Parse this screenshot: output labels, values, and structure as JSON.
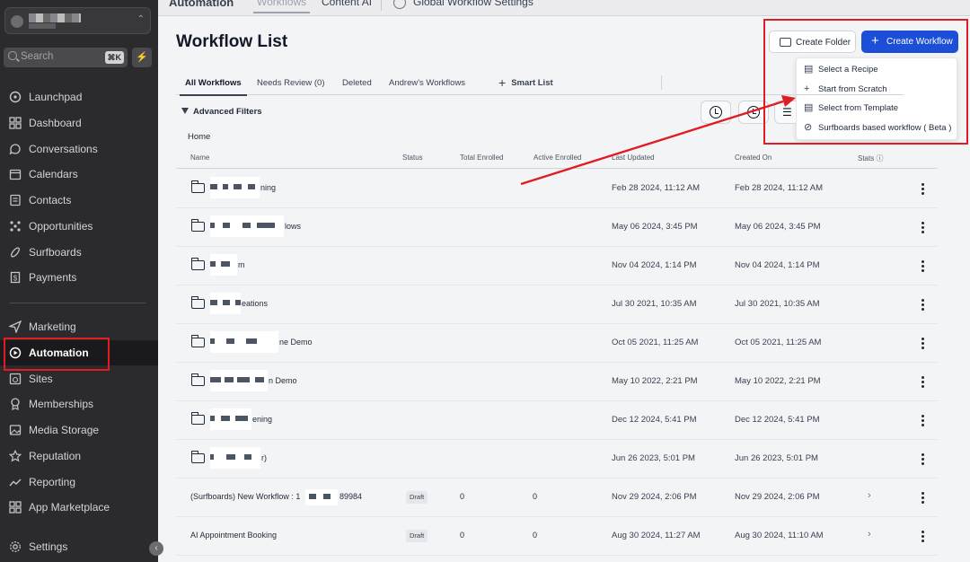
{
  "sidebar": {
    "search_placeholder": "Search",
    "search_shortcut": "⌘K",
    "items": [
      {
        "label": "Launchpad"
      },
      {
        "label": "Dashboard"
      },
      {
        "label": "Conversations"
      },
      {
        "label": "Calendars"
      },
      {
        "label": "Contacts"
      },
      {
        "label": "Opportunities"
      },
      {
        "label": "Surfboards"
      },
      {
        "label": "Payments"
      },
      {
        "label": "Marketing"
      },
      {
        "label": "Automation"
      },
      {
        "label": "Sites"
      },
      {
        "label": "Memberships"
      },
      {
        "label": "Media Storage"
      },
      {
        "label": "Reputation"
      },
      {
        "label": "Reporting"
      },
      {
        "label": "App Marketplace"
      },
      {
        "label": "Settings"
      }
    ],
    "active": "Automation"
  },
  "topbar": {
    "section": "Automation",
    "tabs": [
      "Workflows",
      "Content AI",
      "Global Workflow Settings"
    ]
  },
  "page": {
    "title": "Workflow List",
    "create_folder": "Create Folder",
    "create_workflow": "Create Workflow"
  },
  "dropdown": {
    "items": [
      {
        "label": "Select a Recipe"
      },
      {
        "label": "Start from Scratch"
      },
      {
        "label": "Select from Template"
      },
      {
        "label": "Surfboards based workflow ( Beta )"
      }
    ]
  },
  "subtabs": [
    "All Workflows",
    "Needs Review (0)",
    "Deleted",
    "Andrew's Workflows",
    "Smart List"
  ],
  "filters_label": "Advanced Filters",
  "breadcrumb": "Home",
  "table": {
    "headers": [
      "Name",
      "Status",
      "Total Enrolled",
      "Active Enrolled",
      "Last Updated",
      "Created On",
      "Stats ⓘ"
    ],
    "rows": [
      {
        "name": "ning",
        "last_updated": "Feb 28 2024, 11:12 AM",
        "created_on": "Feb 28 2024, 11:12 AM"
      },
      {
        "name": "lows",
        "last_updated": "May 06 2024, 3:45 PM",
        "created_on": "May 06 2024, 3:45 PM"
      },
      {
        "name": "m",
        "last_updated": "Nov 04 2024, 1:14 PM",
        "created_on": "Nov 04 2024, 1:14 PM"
      },
      {
        "name": "eations",
        "last_updated": "Jul 30 2021, 10:35 AM",
        "created_on": "Jul 30 2021, 10:35 AM"
      },
      {
        "name": "ne Demo",
        "last_updated": "Oct 05 2021, 11:25 AM",
        "created_on": "Oct 05 2021, 11:25 AM"
      },
      {
        "name": "n Demo",
        "last_updated": "May 10 2022, 2:21 PM",
        "created_on": "May 10 2022, 2:21 PM"
      },
      {
        "name": "ening",
        "last_updated": "Dec 12 2024, 5:41 PM",
        "created_on": "Dec 12 2024, 5:41 PM"
      },
      {
        "name": "r)",
        "last_updated": "Jun 26 2023, 5:01 PM",
        "created_on": "Jun 26 2023, 5:01 PM"
      },
      {
        "name": "(Surfboards) New Workflow : 1",
        "name_tail": "89984",
        "status": "Draft",
        "total": "0",
        "active": "0",
        "last_updated": "Nov 29 2024, 2:06 PM",
        "created_on": "Nov 29 2024, 2:06 PM"
      },
      {
        "name": "AI Appointment Booking",
        "status": "Draft",
        "total": "0",
        "active": "0",
        "last_updated": "Aug 30 2024, 11:27 AM",
        "created_on": "Aug 30 2024, 11:10 AM"
      }
    ]
  },
  "colors": {
    "accent": "#1d4ed8",
    "highlight": "#e11d24",
    "sidebar": "#2b2b2d"
  }
}
